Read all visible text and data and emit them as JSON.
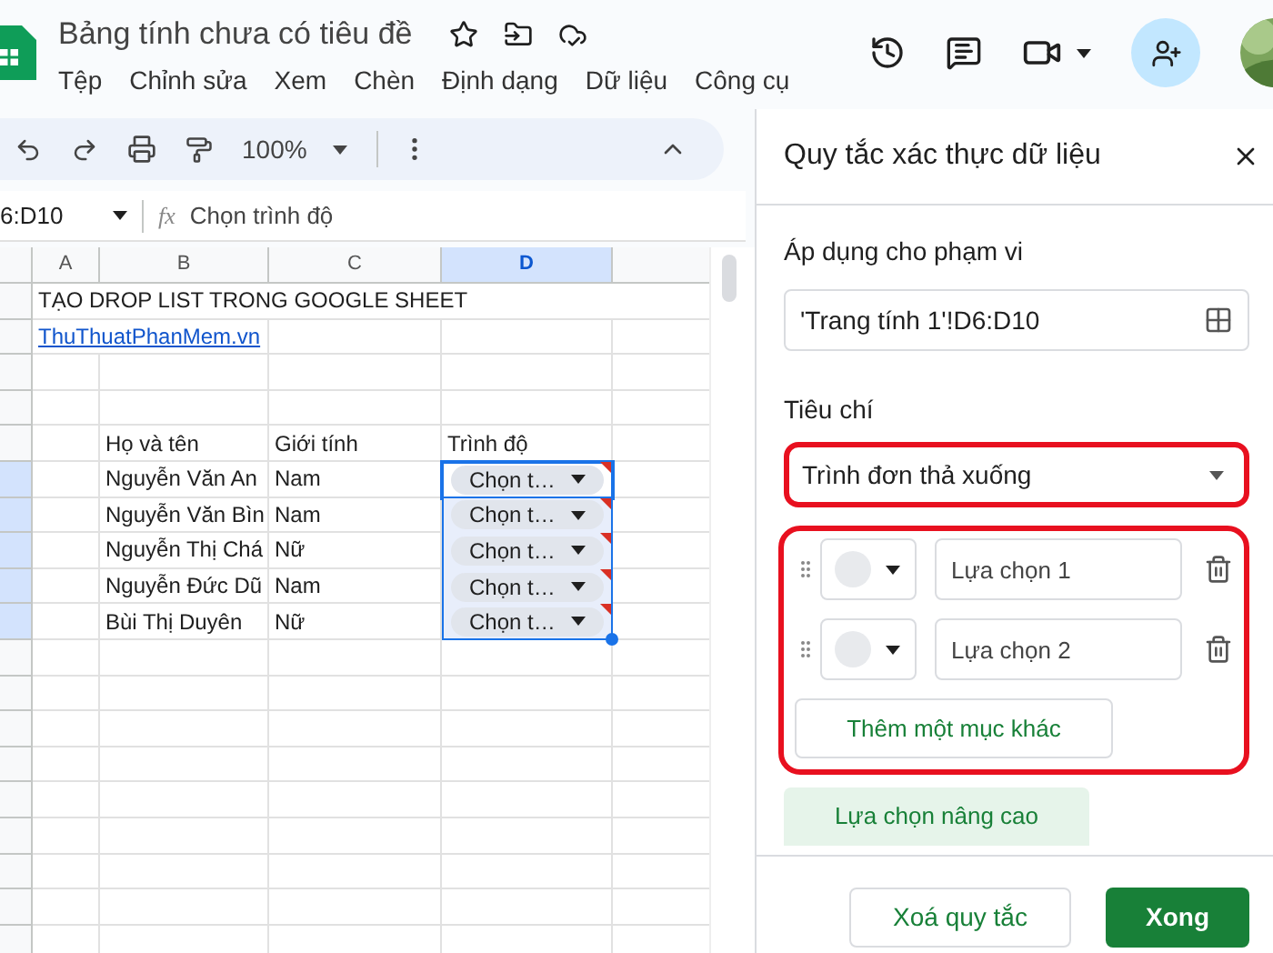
{
  "doc": {
    "title": "Bảng tính chưa có tiêu đề",
    "menu": [
      "Tệp",
      "Chỉnh sửa",
      "Xem",
      "Chèn",
      "Định dạng",
      "Dữ liệu",
      "Công cụ"
    ]
  },
  "toolbar": {
    "zoom": "100%"
  },
  "formula_bar": {
    "name_box": "6:D10",
    "fx": "fx",
    "formula": "Chọn trình độ"
  },
  "sheet": {
    "columns": [
      {
        "label": "A",
        "selected": false
      },
      {
        "label": "B",
        "selected": false
      },
      {
        "label": "C",
        "selected": false
      },
      {
        "label": "D",
        "selected": true
      }
    ],
    "title": "TẠO DROP LIST TRONG GOOGLE SHEET",
    "link": "ThuThuatPhanMem.vn",
    "header": [
      "Họ và tên",
      "Giới tính",
      "Trình độ"
    ],
    "records": [
      {
        "name": "Nguyễn Văn An",
        "gender": "Nam",
        "choice": "Chọn t…",
        "selected": true,
        "active": true
      },
      {
        "name": "Nguyễn Văn Bìn",
        "gender": "Nam",
        "choice": "Chọn t…",
        "selected": true,
        "active": false
      },
      {
        "name": "Nguyễn Thị Chá",
        "gender": "Nữ",
        "choice": "Chọn t…",
        "selected": true,
        "active": false
      },
      {
        "name": "Nguyễn Đức Dũ",
        "gender": "Nam",
        "choice": "Chọn t…",
        "selected": true,
        "active": false
      },
      {
        "name": "Bùi Thị Duyên",
        "gender": "Nữ",
        "choice": "Chọn t…",
        "selected": true,
        "active": false
      }
    ]
  },
  "panel": {
    "title": "Quy tắc xác thực dữ liệu",
    "range_label": "Áp dụng cho phạm vi",
    "range": "'Trang tính 1'!D6:D10",
    "criteria_label": "Tiêu chí",
    "criteria": {
      "value": "Trình đơn thả xuống",
      "highlighted": true
    },
    "options": {
      "highlighted": true,
      "items": [
        {
          "placeholder": "Lựa chọn 1"
        },
        {
          "placeholder": "Lựa chọn 2"
        }
      ],
      "add": "Thêm một mục khác"
    },
    "advanced": "Lựa chọn nâng cao",
    "buttons": {
      "remove": "Xoá quy tắc",
      "done": "Xong"
    }
  }
}
